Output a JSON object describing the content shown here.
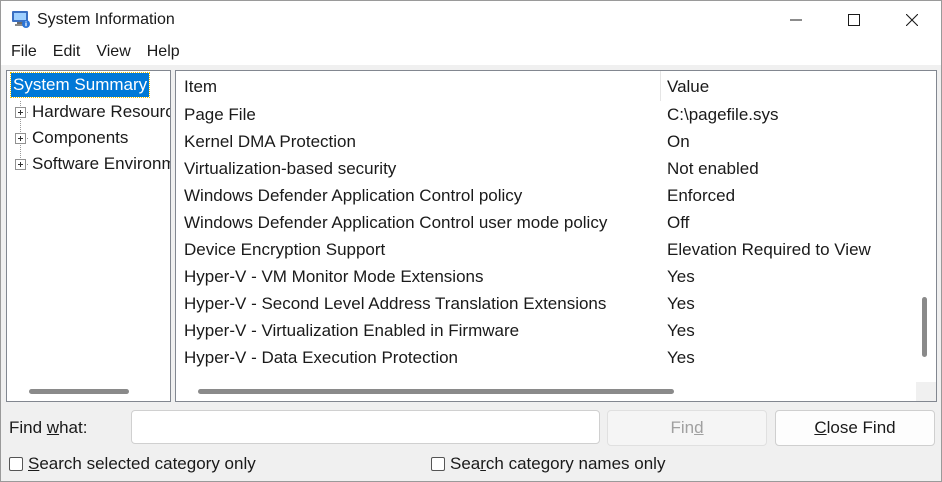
{
  "window": {
    "title": "System Information",
    "icon": "system-information-icon"
  },
  "menu": [
    "File",
    "Edit",
    "View",
    "Help"
  ],
  "tree": {
    "nodes": [
      {
        "label": "System Summary",
        "selected": true
      },
      {
        "label": "Hardware Resources",
        "expandable": true
      },
      {
        "label": "Components",
        "expandable": true
      },
      {
        "label": "Software Environment",
        "expandable": true
      }
    ]
  },
  "table": {
    "columns": [
      "Item",
      "Value"
    ],
    "rows": [
      {
        "item": "Page File",
        "value": "C:\\pagefile.sys"
      },
      {
        "item": "Kernel DMA Protection",
        "value": "On"
      },
      {
        "item": "Virtualization-based security",
        "value": "Not enabled"
      },
      {
        "item": "Windows Defender Application Control policy",
        "value": "Enforced"
      },
      {
        "item": "Windows Defender Application Control user mode policy",
        "value": "Off"
      },
      {
        "item": "Device Encryption Support",
        "value": "Elevation Required to View"
      },
      {
        "item": "Hyper-V - VM Monitor Mode Extensions",
        "value": "Yes"
      },
      {
        "item": "Hyper-V - Second Level Address Translation Extensions",
        "value": "Yes"
      },
      {
        "item": "Hyper-V - Virtualization Enabled in Firmware",
        "value": "Yes"
      },
      {
        "item": "Hyper-V - Data Execution Protection",
        "value": "Yes"
      }
    ]
  },
  "find": {
    "label_pre": "Find ",
    "label_ul": "w",
    "label_post": "hat:",
    "input_value": "",
    "find_button_pre": "Fin",
    "find_button_ul": "d",
    "close_button_ul": "C",
    "close_button_post": "lose Find",
    "check1_ul": "S",
    "check1_post": "earch selected category only",
    "check2_pre": "Sea",
    "check2_ul": "r",
    "check2_post": "ch category names only",
    "check1_checked": false,
    "check2_checked": false
  }
}
